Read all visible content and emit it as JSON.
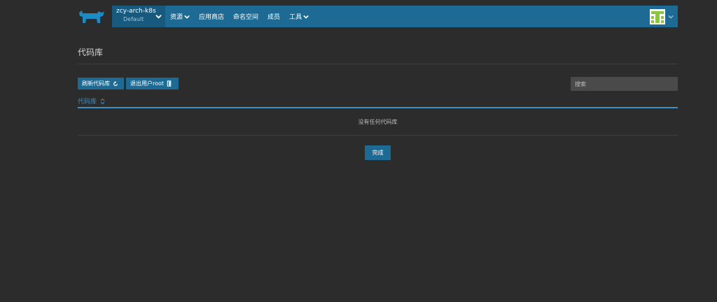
{
  "header": {
    "cluster_name": "zcy-arch-k8s",
    "project_name": "Default",
    "menu": [
      {
        "label": "资源",
        "has_dropdown": true
      },
      {
        "label": "应用商店",
        "has_dropdown": false
      },
      {
        "label": "命名空间",
        "has_dropdown": false
      },
      {
        "label": "成员",
        "has_dropdown": false
      },
      {
        "label": "工具",
        "has_dropdown": true
      }
    ],
    "brand_color": "#1d6b94"
  },
  "page": {
    "title": "代码库",
    "refresh_button": "刷新代码库",
    "logout_button": "退出用户root",
    "search_placeholder": "搜索",
    "column_header": "代码库",
    "empty_message": "没有任何代码库",
    "done_button": "完成"
  },
  "icons": {
    "logo": "rancher-logo-icon",
    "refresh": "refresh-icon",
    "logout": "logout-icon",
    "sort": "sort-icon",
    "avatar": "user-avatar-icon"
  }
}
